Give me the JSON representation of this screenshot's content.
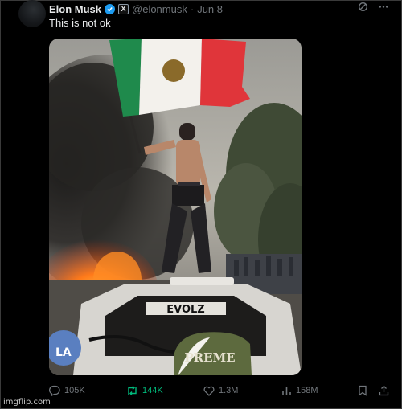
{
  "post": {
    "author_name": "Elon Musk",
    "handle": "@elonmusk",
    "separator": "·",
    "date": "Jun 8",
    "text": "This is not ok",
    "badge_letter": "X"
  },
  "media": {
    "stencil_text": "EVOLZ",
    "cap_text": "PREME",
    "cap_logo": "LA"
  },
  "actions": {
    "replies": "105K",
    "reposts": "144K",
    "likes": "1.3M",
    "views": "158M"
  },
  "watermark": "imgflip.com",
  "colors": {
    "background": "#000000",
    "text": "#e7e9ea",
    "muted": "#71767b",
    "verified": "#1d9bf0",
    "repost_active": "#00ba7c",
    "flag_green": "#1f8a4c",
    "flag_red": "#e0353a"
  },
  "icons": [
    "grok-icon",
    "more-icon",
    "reply-icon",
    "repost-icon",
    "like-icon",
    "views-icon",
    "bookmark-icon",
    "share-icon"
  ]
}
